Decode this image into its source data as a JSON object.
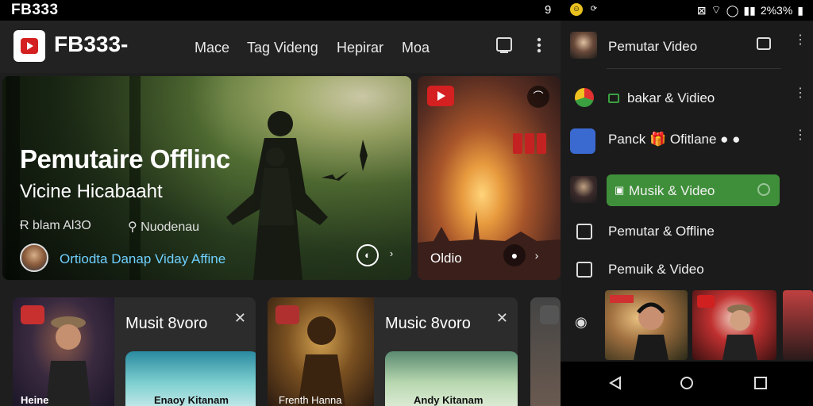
{
  "status_bar": {
    "left": "FB333",
    "notification": "9",
    "right": "2%3%"
  },
  "app": {
    "title": "FB333-",
    "nav": [
      "Mace",
      "Tag Videng",
      "Hepirar",
      "Moa"
    ]
  },
  "hero": {
    "title": "Pemutaire Offlinc",
    "subtitle": "Vicine Hicabaaht",
    "meta_left": "Ɍ blam Al3O",
    "meta_right": "Nuodenau",
    "user_line": "Ortiodta Danap  Viday Affine"
  },
  "side_card": {
    "label": "Oldio"
  },
  "bottom_cards": [
    {
      "title": "Musit 8voro",
      "thumb_text": "Heine",
      "inner_text": "Enaoy Kitanam"
    },
    {
      "title": "Music 8voro",
      "thumb_text": "Frenth Hanna",
      "inner_text": "Andy Kitanam"
    }
  ],
  "drawer": {
    "header": "Pemutar Video",
    "items": [
      {
        "label": "bakar & Vidieo"
      },
      {
        "label": "Panck 🎁 Ofitlane ● ●"
      },
      {
        "label": "Musik & Video"
      },
      {
        "label": "Pemutar & Offline"
      },
      {
        "label": "Pemuik & Video"
      }
    ]
  },
  "colors": {
    "accent_green": "#3f8f3a",
    "brand_red": "#d42020",
    "link_blue": "#6fd0ff"
  }
}
